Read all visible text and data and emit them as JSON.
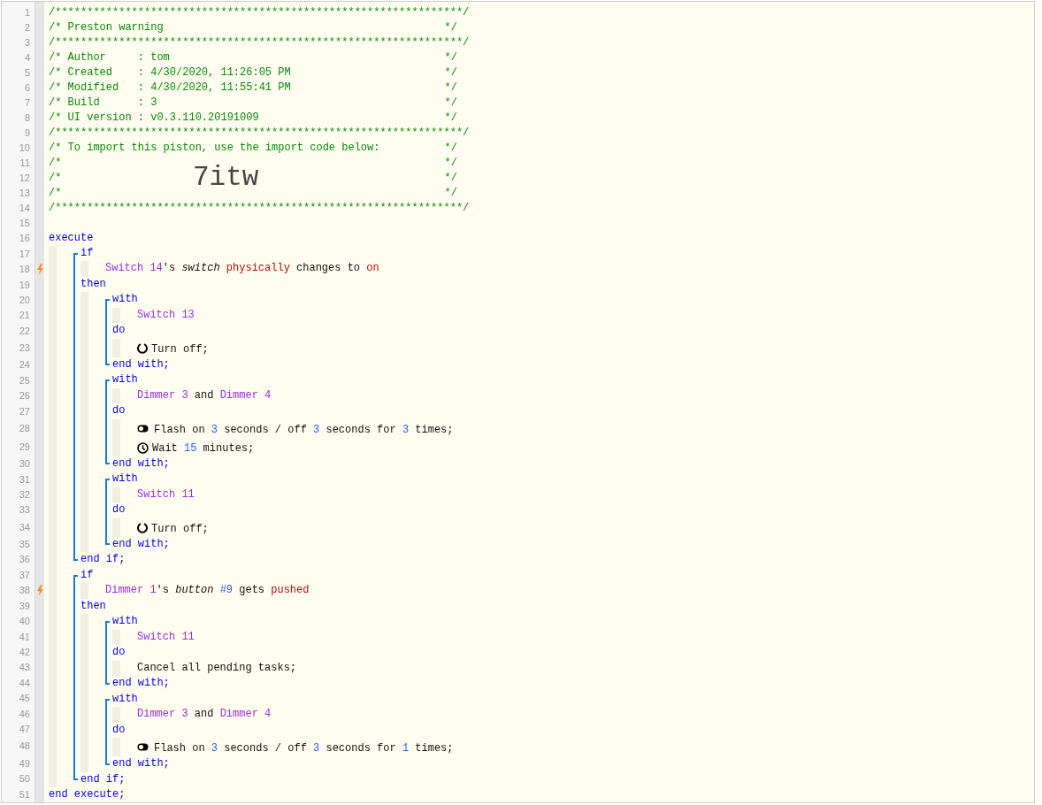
{
  "header": [
    {
      "number": "1",
      "text": "/****************************************************************/"
    },
    {
      "number": "2",
      "text": "/* Preston warning",
      "close": "*/"
    },
    {
      "number": "3",
      "text": "/****************************************************************/"
    },
    {
      "number": "4",
      "text": "/* Author     : tom",
      "close": "*/"
    },
    {
      "number": "5",
      "text": "/* Created    : 4/30/2020, 11:26:05 PM",
      "close": "*/"
    },
    {
      "number": "6",
      "text": "/* Modified   : 4/30/2020, 11:55:41 PM",
      "close": "*/"
    },
    {
      "number": "7",
      "text": "/* Build      : 3",
      "close": "*/"
    },
    {
      "number": "8",
      "text": "/* UI version : v0.3.110.20191009",
      "close": "*/"
    },
    {
      "number": "9",
      "text": "/****************************************************************/"
    },
    {
      "number": "10",
      "text": "/* To import this piston, use the import code below:",
      "close": "*/"
    },
    {
      "number": "11",
      "text": "/*",
      "close": "*/"
    },
    {
      "number": "12",
      "text": "/*",
      "close": "*/",
      "import_code": "7itw"
    },
    {
      "number": "13",
      "text": "/*",
      "close": "*/"
    },
    {
      "number": "14",
      "text": "/****************************************************************/"
    },
    {
      "number": "15"
    }
  ],
  "program": [
    {
      "kind": "line",
      "number": "16",
      "tokens": [
        {
          "kind": "keyword",
          "text": "execute"
        }
      ]
    },
    {
      "kind": "body",
      "items": [
        {
          "kind": "bracket",
          "items": [
            {
              "kind": "line",
              "number": "17",
              "tokens": [
                {
                  "kind": "keyword",
                  "text": "if"
                }
              ]
            },
            {
              "kind": "body",
              "items": [
                {
                  "kind": "condition",
                  "number": "18",
                  "trigger": true,
                  "tokens": [
                    {
                      "kind": "device",
                      "text": "Switch 14"
                    },
                    {
                      "kind": "text",
                      "text": "'s "
                    },
                    {
                      "kind": "attribute",
                      "text": "switch"
                    },
                    {
                      "kind": "value",
                      "text": " physically"
                    },
                    {
                      "kind": "text",
                      "text": " changes to "
                    },
                    {
                      "kind": "value",
                      "text": "on"
                    }
                  ]
                }
              ]
            },
            {
              "kind": "line",
              "number": "19",
              "tokens": [
                {
                  "kind": "keyword",
                  "text": "then"
                }
              ]
            },
            {
              "kind": "body",
              "items": [
                {
                  "kind": "bracket",
                  "items": [
                    {
                      "kind": "line",
                      "number": "20",
                      "tokens": [
                        {
                          "kind": "keyword",
                          "text": "with"
                        }
                      ]
                    },
                    {
                      "kind": "body",
                      "items": [
                        {
                          "kind": "line",
                          "number": "21",
                          "tokens": [
                            {
                              "kind": "device",
                              "text": "Switch 13"
                            }
                          ]
                        }
                      ]
                    },
                    {
                      "kind": "line",
                      "number": "22",
                      "tokens": [
                        {
                          "kind": "keyword",
                          "text": "do"
                        }
                      ]
                    },
                    {
                      "kind": "body",
                      "items": [
                        {
                          "kind": "power_action",
                          "number": "23",
                          "tokens": [
                            {
                              "kind": "text",
                              "text": "Turn off;"
                            }
                          ]
                        }
                      ]
                    },
                    {
                      "kind": "line",
                      "number": "24",
                      "tokens": [
                        {
                          "kind": "keyword",
                          "text": "end with;"
                        }
                      ]
                    }
                  ]
                },
                {
                  "kind": "bracket",
                  "items": [
                    {
                      "kind": "line",
                      "number": "25",
                      "tokens": [
                        {
                          "kind": "keyword",
                          "text": "with"
                        }
                      ]
                    },
                    {
                      "kind": "body",
                      "items": [
                        {
                          "kind": "line",
                          "number": "26",
                          "tokens": [
                            {
                              "kind": "device",
                              "text": "Dimmer 3"
                            },
                            {
                              "kind": "text",
                              "text": " and "
                            },
                            {
                              "kind": "device",
                              "text": "Dimmer 4"
                            }
                          ]
                        }
                      ]
                    },
                    {
                      "kind": "line",
                      "number": "27",
                      "tokens": [
                        {
                          "kind": "keyword",
                          "text": "do"
                        }
                      ]
                    },
                    {
                      "kind": "body",
                      "items": [
                        {
                          "kind": "flash_action",
                          "number": "28",
                          "tokens": [
                            {
                              "kind": "text",
                              "text": "Flash on "
                            },
                            {
                              "kind": "number",
                              "text": "3"
                            },
                            {
                              "kind": "text",
                              "text": " seconds / off "
                            },
                            {
                              "kind": "number",
                              "text": "3"
                            },
                            {
                              "kind": "text",
                              "text": " seconds for "
                            },
                            {
                              "kind": "number",
                              "text": "3"
                            },
                            {
                              "kind": "text",
                              "text": " times;"
                            }
                          ]
                        },
                        {
                          "kind": "wait_action",
                          "number": "29",
                          "tokens": [
                            {
                              "kind": "text",
                              "text": "Wait "
                            },
                            {
                              "kind": "number",
                              "text": "15"
                            },
                            {
                              "kind": "text",
                              "text": " minutes;"
                            }
                          ]
                        }
                      ]
                    },
                    {
                      "kind": "line",
                      "number": "30",
                      "tokens": [
                        {
                          "kind": "keyword",
                          "text": "end with;"
                        }
                      ]
                    }
                  ]
                },
                {
                  "kind": "bracket",
                  "items": [
                    {
                      "kind": "line",
                      "number": "31",
                      "tokens": [
                        {
                          "kind": "keyword",
                          "text": "with"
                        }
                      ]
                    },
                    {
                      "kind": "body",
                      "items": [
                        {
                          "kind": "line",
                          "number": "32",
                          "tokens": [
                            {
                              "kind": "device",
                              "text": "Switch 11"
                            }
                          ]
                        }
                      ]
                    },
                    {
                      "kind": "line",
                      "number": "33",
                      "tokens": [
                        {
                          "kind": "keyword",
                          "text": "do"
                        }
                      ]
                    },
                    {
                      "kind": "body",
                      "items": [
                        {
                          "kind": "power_action",
                          "number": "34",
                          "tokens": [
                            {
                              "kind": "text",
                              "text": "Turn off;"
                            }
                          ]
                        }
                      ]
                    },
                    {
                      "kind": "line",
                      "number": "35",
                      "tokens": [
                        {
                          "kind": "keyword",
                          "text": "end with;"
                        }
                      ]
                    }
                  ]
                }
              ]
            },
            {
              "kind": "line",
              "number": "36",
              "tokens": [
                {
                  "kind": "keyword",
                  "text": "end if;"
                }
              ]
            }
          ]
        },
        {
          "kind": "bracket",
          "items": [
            {
              "kind": "line",
              "number": "37",
              "tokens": [
                {
                  "kind": "keyword",
                  "text": "if"
                }
              ]
            },
            {
              "kind": "body",
              "items": [
                {
                  "kind": "condition",
                  "number": "38",
                  "trigger": true,
                  "tokens": [
                    {
                      "kind": "device",
                      "text": "Dimmer 1"
                    },
                    {
                      "kind": "text",
                      "text": "'s "
                    },
                    {
                      "kind": "attribute",
                      "text": "button"
                    },
                    {
                      "kind": "number",
                      "text": " #9"
                    },
                    {
                      "kind": "text",
                      "text": " gets "
                    },
                    {
                      "kind": "value",
                      "text": "pushed"
                    }
                  ]
                }
              ]
            },
            {
              "kind": "line",
              "number": "39",
              "tokens": [
                {
                  "kind": "keyword",
                  "text": "then"
                }
              ]
            },
            {
              "kind": "body",
              "items": [
                {
                  "kind": "bracket",
                  "items": [
                    {
                      "kind": "line",
                      "number": "40",
                      "tokens": [
                        {
                          "kind": "keyword",
                          "text": "with"
                        }
                      ]
                    },
                    {
                      "kind": "body",
                      "items": [
                        {
                          "kind": "line",
                          "number": "41",
                          "tokens": [
                            {
                              "kind": "device",
                              "text": "Switch 11"
                            }
                          ]
                        }
                      ]
                    },
                    {
                      "kind": "line",
                      "number": "42",
                      "tokens": [
                        {
                          "kind": "keyword",
                          "text": "do"
                        }
                      ]
                    },
                    {
                      "kind": "body",
                      "items": [
                        {
                          "kind": "line",
                          "number": "43",
                          "tokens": [
                            {
                              "kind": "text",
                              "text": "Cancel all pending tasks;"
                            }
                          ]
                        }
                      ]
                    },
                    {
                      "kind": "line",
                      "number": "44",
                      "tokens": [
                        {
                          "kind": "keyword",
                          "text": "end with;"
                        }
                      ]
                    }
                  ]
                },
                {
                  "kind": "bracket",
                  "items": [
                    {
                      "kind": "line",
                      "number": "45",
                      "tokens": [
                        {
                          "kind": "keyword",
                          "text": "with"
                        }
                      ]
                    },
                    {
                      "kind": "body",
                      "items": [
                        {
                          "kind": "line",
                          "number": "46",
                          "tokens": [
                            {
                              "kind": "device",
                              "text": "Dimmer 3"
                            },
                            {
                              "kind": "text",
                              "text": " and "
                            },
                            {
                              "kind": "device",
                              "text": "Dimmer 4"
                            }
                          ]
                        }
                      ]
                    },
                    {
                      "kind": "line",
                      "number": "47",
                      "tokens": [
                        {
                          "kind": "keyword",
                          "text": "do"
                        }
                      ]
                    },
                    {
                      "kind": "body",
                      "items": [
                        {
                          "kind": "flash_action",
                          "number": "48",
                          "tokens": [
                            {
                              "kind": "text",
                              "text": "Flash on "
                            },
                            {
                              "kind": "number",
                              "text": "3"
                            },
                            {
                              "kind": "text",
                              "text": " seconds / off "
                            },
                            {
                              "kind": "number",
                              "text": "3"
                            },
                            {
                              "kind": "text",
                              "text": " seconds for "
                            },
                            {
                              "kind": "number",
                              "text": "1"
                            },
                            {
                              "kind": "text",
                              "text": " times;"
                            }
                          ]
                        }
                      ]
                    },
                    {
                      "kind": "line",
                      "number": "49",
                      "tokens": [
                        {
                          "kind": "keyword",
                          "text": "end with;"
                        }
                      ]
                    }
                  ]
                }
              ]
            },
            {
              "kind": "line",
              "number": "50",
              "tokens": [
                {
                  "kind": "keyword",
                  "text": "end if;"
                }
              ]
            }
          ]
        }
      ]
    },
    {
      "kind": "line",
      "number": "51",
      "tokens": [
        {
          "kind": "keyword",
          "text": "end execute;"
        }
      ]
    }
  ]
}
